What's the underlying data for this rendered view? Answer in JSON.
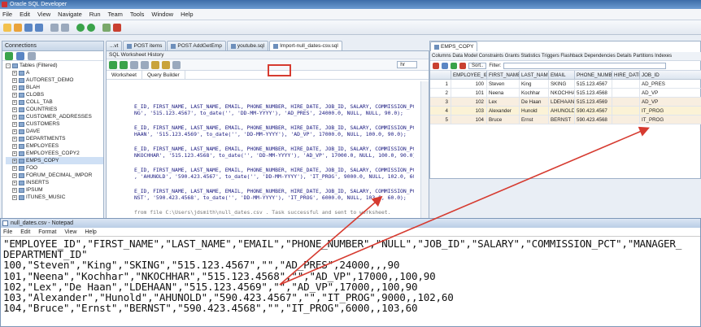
{
  "app": {
    "title": "Oracle SQL Developer"
  },
  "menu": [
    "File",
    "Edit",
    "View",
    "Navigate",
    "Run",
    "Team",
    "Tools",
    "Window",
    "Help"
  ],
  "connections": {
    "header": "Connections",
    "tree": [
      "Tables (Filtered)",
      "A",
      "AUTOREST_DEMO",
      "BLAH",
      "CLOBS",
      "COLL_TAB",
      "COUNTRIES",
      "CUSTOMER_ADDRESSES",
      "CUSTOMERS",
      "DAVE",
      "DEPARTMENTS",
      "EMPLOYEES",
      "EMPLOYEES_COPY2",
      "EMPS_COPY",
      "FOO",
      "FORUM_DECIMAL_IMPOR",
      "INSERTS",
      "IPSUM",
      "ITUNES_MUSIC"
    ]
  },
  "editor_tabs": [
    "...vt",
    "POST items",
    "POST AddGetEmp",
    "youtube.sql",
    "Import-null_dates-csv.sql"
  ],
  "worksheet": {
    "tabs": "SQL Worksheet  History",
    "subtabs": [
      "Worksheet",
      "Query Builder"
    ],
    "connection": "hr",
    "lines": [
      "E_ID, FIRST_NAME, LAST_NAME, EMAIL, PHONE_NUMBER, HIRE_DATE, JOB_ID, SALARY, COMMISSION_PC",
      "NG', '515.123.4567', to_date('', 'DD-MM-YYYY'), 'AD_PRES', 24000.0, NULL, NULL, 90.0);",
      "E_ID, FIRST_NAME, LAST_NAME, EMAIL, PHONE_NUMBER, HIRE_DATE, JOB_ID, SALARY, COMMISSION_PC",
      "HAAN', '515.123.4569', to_date('', 'DD-MM-YYYY'), 'AD_VP', 17000.0, NULL, 100.0, 90.0);",
      "E_ID, FIRST_NAME, LAST_NAME, EMAIL, PHONE_NUMBER, HIRE_DATE, JOB_ID, SALARY, COMMISSION_PC",
      "NKOCHHAR', '515.123.4568', to_date('', 'DD-MM-YYYY'), 'AD_VP', 17000.0, NULL, 100.0, 90.0);",
      "E_ID, FIRST_NAME, LAST_NAME, EMAIL, PHONE_NUMBER, HIRE_DATE, JOB_ID, SALARY, COMMISSION_PC",
      ", 'AHUNOLD', '590.423.4567', to_date('', 'DD-MM-YYYY'), 'IT_PROG', 9000.0, NULL, 102.0, 60.0);",
      "E_ID, FIRST_NAME, LAST_NAME, EMAIL, PHONE_NUMBER, HIRE_DATE, JOB_ID, SALARY, COMMISSION_PC",
      "NST', '590.423.4568', to_date('', 'DD-MM-YYYY'), 'IT_PROG', 6000.0, NULL, 103.0, 60.0);",
      "from file C:\\Users\\jdsmith\\null_dates.csv .  Task successful and sent to worksheet."
    ]
  },
  "results": {
    "tab": "EMPS_COPY",
    "subtabs": "Columns  Data  Model  Constraints  Grants  Statistics  Triggers  Flashback  Dependencies  Details  Partitions  Indexes",
    "sort_label": "Sort..",
    "filter_label": "Filter:",
    "headers": [
      "",
      "EMPLOYEE_ID",
      "FIRST_NAME",
      "LAST_NAME",
      "EMAIL",
      "PHONE_NUMBER",
      "HIRE_DATE",
      "JOB_ID"
    ],
    "rows": [
      [
        "1",
        "100",
        "Steven",
        "King",
        "SKING",
        "515.123.4567",
        "",
        "AD_PRES"
      ],
      [
        "2",
        "101",
        "Neena",
        "Kochhar",
        "NKOCHHAR",
        "515.123.4568",
        "",
        "AD_VP"
      ],
      [
        "3",
        "102",
        "Lex",
        "De Haan",
        "LDEHAAN",
        "515.123.4569",
        "",
        "AD_VP"
      ],
      [
        "4",
        "103",
        "Alexander",
        "Hunold",
        "AHUNOLD",
        "590.423.4567",
        "",
        "IT_PROG"
      ],
      [
        "5",
        "104",
        "Bruce",
        "Ernst",
        "BERNST",
        "590.423.4568",
        "",
        "IT_PROG"
      ]
    ]
  },
  "notepad": {
    "title": "null_dates.csv - Notepad",
    "menu": [
      "File",
      "Edit",
      "Format",
      "View",
      "Help"
    ],
    "lines": [
      "\"EMPLOYEE_ID\",\"FIRST_NAME\",\"LAST_NAME\",\"EMAIL\",\"PHONE_NUMBER\",\"NULL\",\"JOB_ID\",\"SALARY\",\"COMMISSION_PCT\",\"MANAGER_",
      "DEPARTMENT_ID\"",
      "100,\"Steven\",\"King\",\"SKING\",\"515.123.4567\",\"\",\"AD_PRES\",24000,,,90",
      "101,\"Neena\",\"Kochhar\",\"NKOCHHAR\",\"515.123.4568\",\"\",\"AD_VP\",17000,,100,90",
      "102,\"Lex\",\"De Haan\",\"LDEHAAN\",\"515.123.4569\",\"\",\"AD_VP\",17000,,100,90",
      "103,\"Alexander\",\"Hunold\",\"AHUNOLD\",\"590.423.4567\",\"\",\"IT_PROG\",9000,,102,60",
      "104,\"Bruce\",\"Ernst\",\"BERNST\",\"590.423.4568\",\"\",\"IT_PROG\",6000,,103,60"
    ]
  },
  "colors": {
    "highlight": "#d63b30",
    "accent": "#3d6da8"
  }
}
